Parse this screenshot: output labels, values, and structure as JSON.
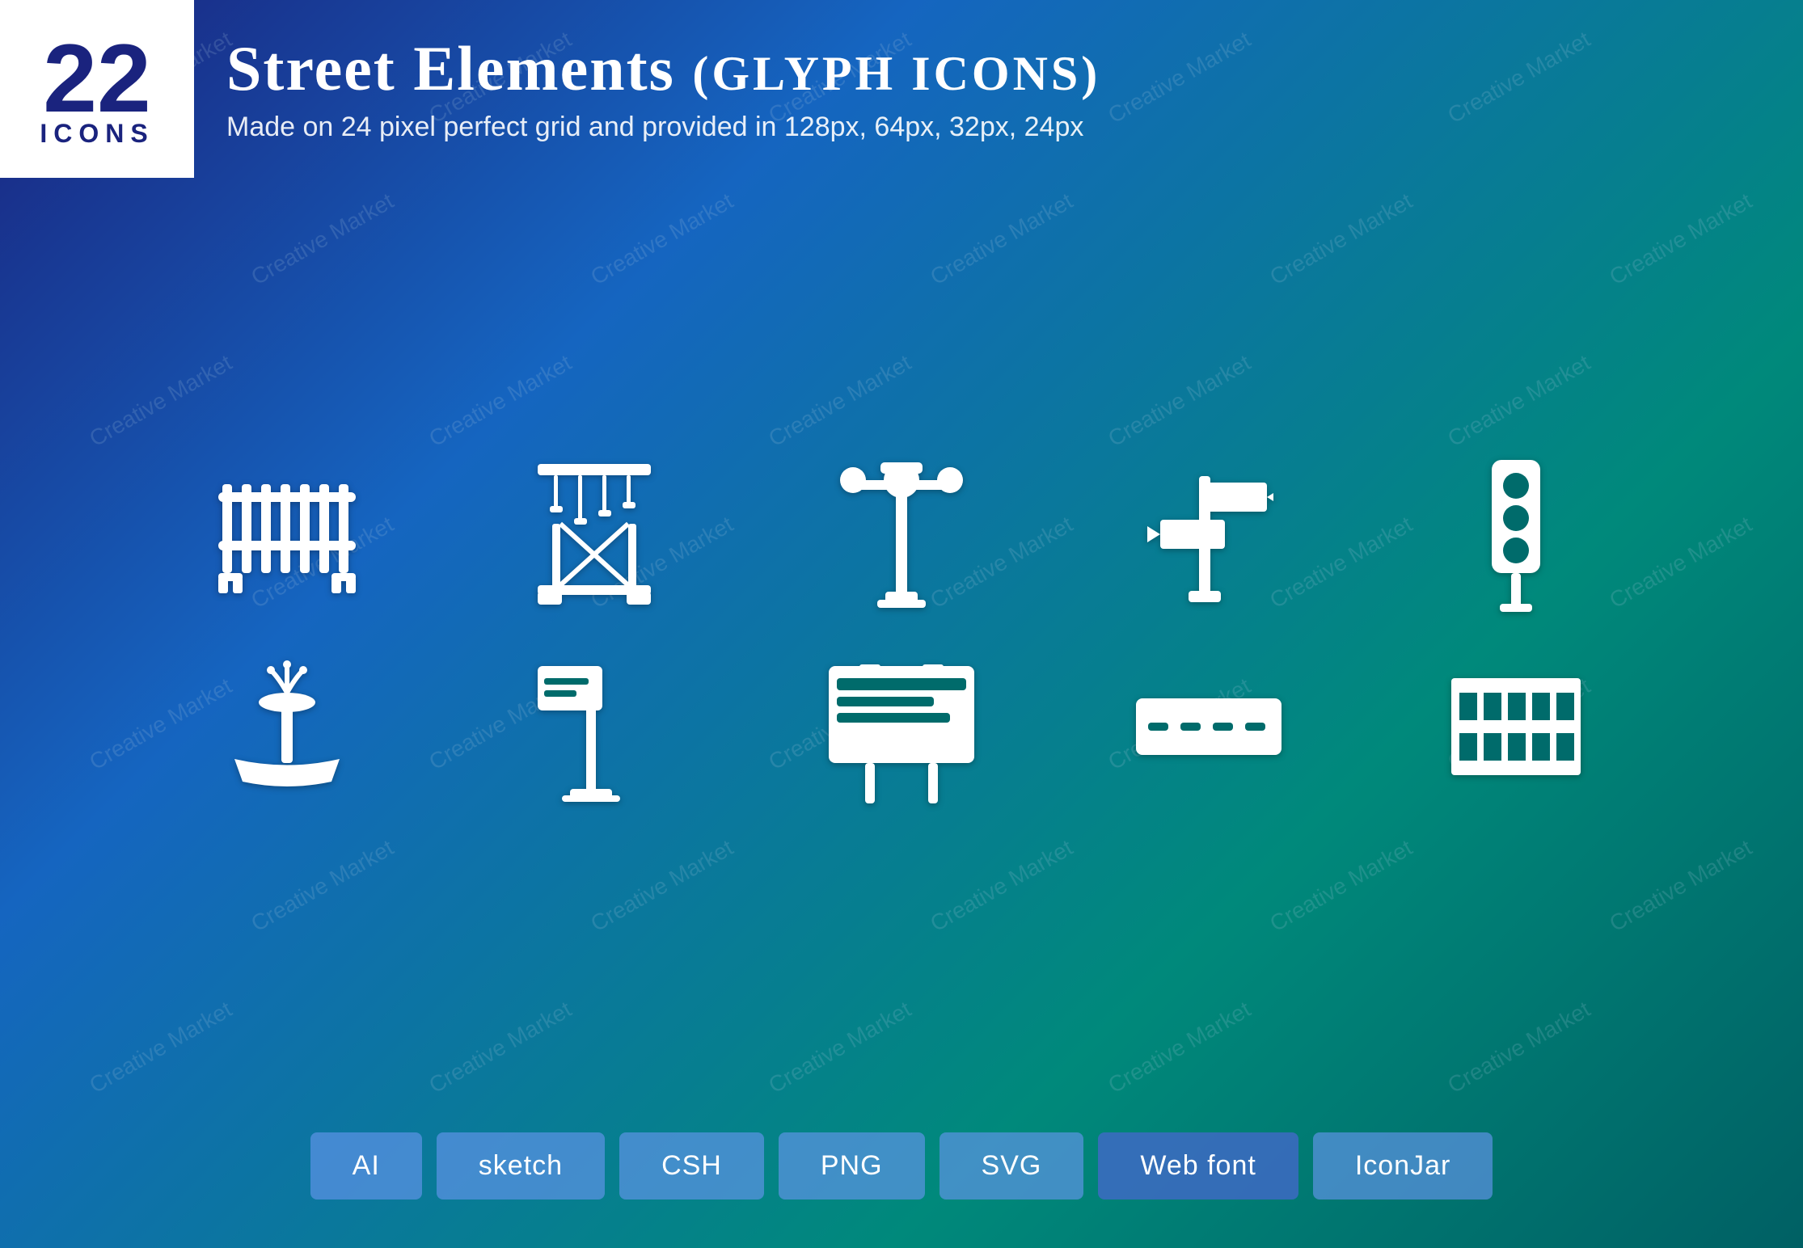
{
  "badge": {
    "number": "22",
    "label": "ICONS"
  },
  "header": {
    "title_part1": "Street Elements",
    "title_part2": "(Glyph Icons)",
    "subtitle": "Made on 24 pixel perfect grid and provided in 128px, 64px, 32px, 24px"
  },
  "icons_row1": [
    {
      "name": "fence-icon",
      "desc": "metal fence / barrier"
    },
    {
      "name": "crane-icon",
      "desc": "construction crane"
    },
    {
      "name": "street-lamp-icon",
      "desc": "street lamp post"
    },
    {
      "name": "signpost-icon",
      "desc": "directional signpost"
    },
    {
      "name": "traffic-light-icon",
      "desc": "traffic light"
    }
  ],
  "icons_row2": [
    {
      "name": "fountain-icon",
      "desc": "water fountain"
    },
    {
      "name": "flag-sign-icon",
      "desc": "flag on pole sign"
    },
    {
      "name": "billboard-icon",
      "desc": "billboard sign"
    },
    {
      "name": "road-icon",
      "desc": "road / street"
    },
    {
      "name": "radiator-fence-icon",
      "desc": "radiator or fence grill"
    }
  ],
  "buttons": [
    {
      "id": "btn-ai",
      "label": "AI"
    },
    {
      "id": "btn-sketch",
      "label": "sketch"
    },
    {
      "id": "btn-csh",
      "label": "CSH"
    },
    {
      "id": "btn-png",
      "label": "PNG"
    },
    {
      "id": "btn-svg",
      "label": "SVG"
    },
    {
      "id": "btn-webfont",
      "label": "Web font"
    },
    {
      "id": "btn-iconjar",
      "label": "IconJar"
    }
  ],
  "watermarks": [
    "Creative Market",
    "Creative Market",
    "Creative Market"
  ]
}
